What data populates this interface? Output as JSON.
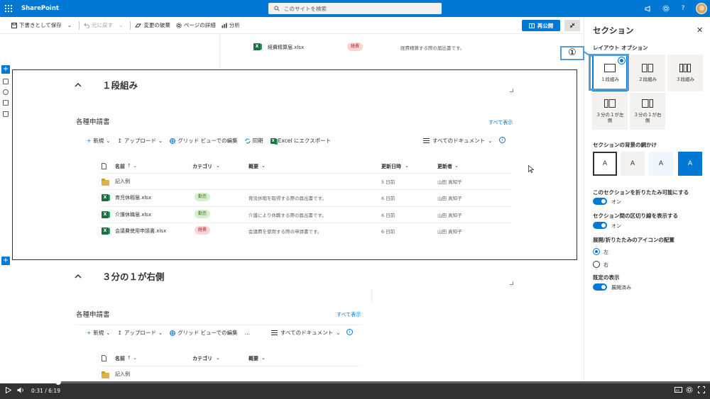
{
  "suitebar": {
    "brand": "SharePoint",
    "search_placeholder": "このサイトを検索",
    "icons": [
      "waffle-icon",
      "megaphone-icon",
      "gear-icon",
      "help-icon",
      "avatar"
    ]
  },
  "commandbar": {
    "save_draft": "下書きとして保存",
    "undo": "元に戻す",
    "discard": "変更の破棄",
    "page_details": "ページの詳細",
    "analytics": "分析",
    "republish": "再公開"
  },
  "canvas": {
    "top_file": {
      "name": "経費精算届.xlsx",
      "category": "経費",
      "summary": "経費精算する際の届出書です。"
    },
    "section1": {
      "title": "１段組み"
    },
    "section2": {
      "title": "３分の１が右側"
    },
    "library": {
      "title": "各種申請書",
      "see_all": "すべて表示",
      "commands": {
        "new": "新規",
        "upload": "アップロード",
        "grid_edit": "グリッド ビューでの編集",
        "sync": "同期",
        "export": "Excel にエクスポート",
        "more": "…",
        "view": "すべてのドキュメント"
      },
      "columns": {
        "name": "名前",
        "category": "カテゴリ",
        "summary": "概要",
        "modified": "更新日時",
        "modified_by": "更新者"
      },
      "rows": [
        {
          "name": "記入例",
          "type": "folder",
          "category": "",
          "summary": "",
          "modified": "5 日前",
          "modified_by": "山田 真知子"
        },
        {
          "name": "育児休暇届.xlsx",
          "type": "xlsx",
          "category": "勤怠",
          "summary": "育児休暇を取得する際の届出書です。",
          "modified": "6 日前",
          "modified_by": "山田 真知子"
        },
        {
          "name": "介護休職届.xlsx",
          "type": "xlsx",
          "category": "勤怠",
          "summary": "介護により休職する際の届出書です。",
          "modified": "6 日前",
          "modified_by": "山田 真知子"
        },
        {
          "name": "会議費使用申請書.xlsx",
          "type": "xlsx",
          "category": "経費",
          "summary": "会議費を使用する際の申請書です。",
          "modified": "6 日前",
          "modified_by": "山田 真知子"
        }
      ]
    }
  },
  "pane": {
    "title": "セクション",
    "layout_label": "レイアウト オプション",
    "layouts": [
      {
        "label": "１段組み",
        "selected": true
      },
      {
        "label": "２段組み",
        "selected": false
      },
      {
        "label": "３段組み",
        "selected": false
      },
      {
        "label": "３分の１が左側",
        "selected": false
      },
      {
        "label": "３分の１が右側",
        "selected": false
      }
    ],
    "background_label": "セクションの背景の網かけ",
    "swatch_glyph": "A",
    "collapsible_label": "このセクションを折りたたみ可能にする",
    "collapsible_value": "オン",
    "divider_label": "セクション間の区切り線を表示する",
    "divider_value": "オン",
    "icon_position_label": "展開/折りたたみのアイコンの配置",
    "icon_position_left": "左",
    "icon_position_right": "右",
    "default_label": "既定の表示",
    "default_value": "展開済み"
  },
  "annotation": {
    "marker": "①"
  },
  "video": {
    "time": "0:31 / 6:19",
    "progress": 0.082
  },
  "colors": {
    "accent": "#0078d4",
    "annotation": "#5b9bd5",
    "badge_green": "#d6efd0",
    "badge_red": "#f9d6d4"
  }
}
